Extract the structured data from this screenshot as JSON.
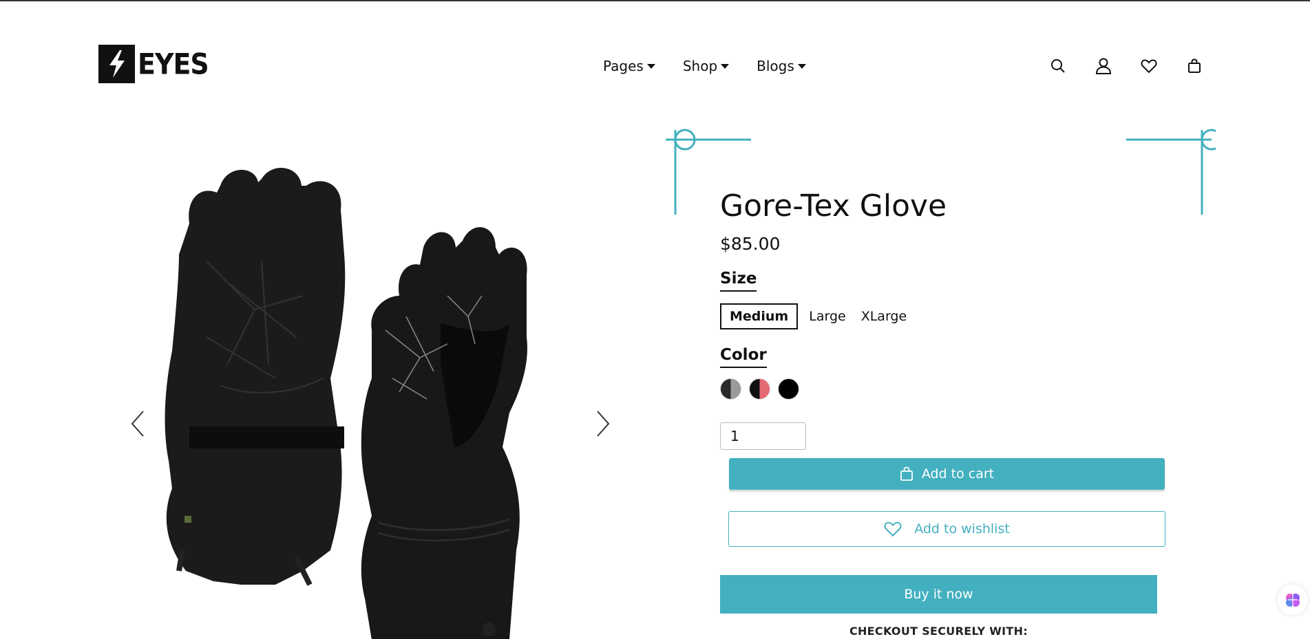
{
  "brand": {
    "logo_text": "EYES"
  },
  "nav": {
    "items": [
      {
        "label": "Pages"
      },
      {
        "label": "Shop"
      },
      {
        "label": "Blogs"
      }
    ]
  },
  "header_icons": [
    "search-icon",
    "account-icon",
    "wishlist-heart-icon",
    "cart-bag-icon"
  ],
  "product": {
    "title": "Gore-Tex Glove",
    "price": "$85.00",
    "size_label": "Size",
    "sizes": [
      "Medium",
      "Large",
      "XLarge"
    ],
    "selected_size": "Medium",
    "color_label": "Color",
    "colors": [
      {
        "name": "black-grey",
        "left": "#2a2a2a",
        "right": "#9a9a9a"
      },
      {
        "name": "black-red",
        "left": "#111111",
        "right": "#e46a74"
      },
      {
        "name": "black",
        "left": "#000000",
        "right": "#000000"
      }
    ],
    "quantity": "1"
  },
  "actions": {
    "add_to_cart": "Add to cart",
    "add_to_wishlist": "Add to wishlist",
    "buy_now": "Buy it now",
    "checkout_text": "CHECKOUT SECURELY WITH:"
  },
  "theme": {
    "accent": "#43b0bf",
    "text": "#111111"
  }
}
